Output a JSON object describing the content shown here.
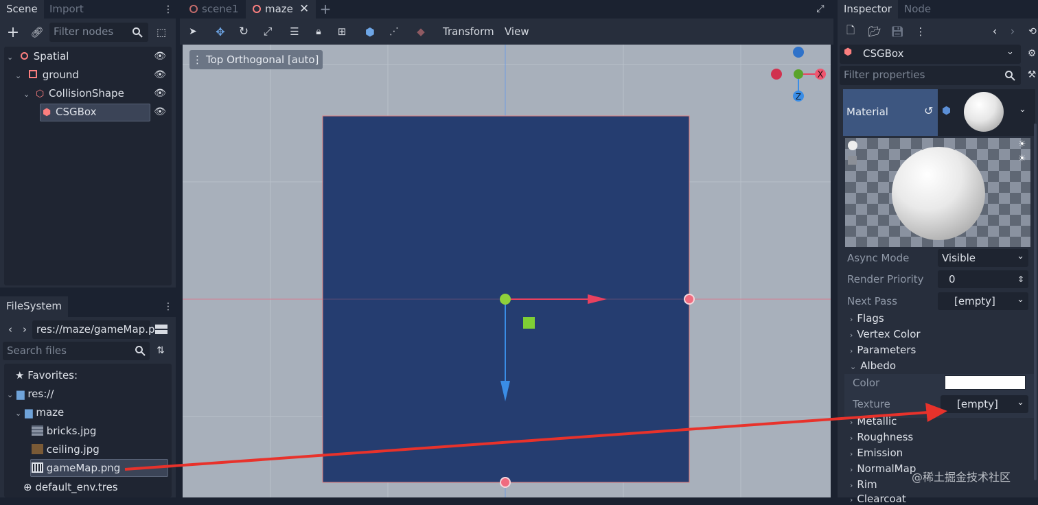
{
  "scene_dock": {
    "tabs": [
      "Scene",
      "Import"
    ],
    "filter_placeholder": "Filter nodes",
    "nodes": [
      "Spatial",
      "ground",
      "CollisionShape",
      "CSGBox"
    ]
  },
  "filesystem": {
    "tab": "FileSystem",
    "path": "res://maze/gameMap.p",
    "search_placeholder": "Search files",
    "items": [
      "Favorites:",
      "res://",
      "maze",
      "bricks.jpg",
      "ceiling.jpg",
      "gameMap.png",
      "default_env.tres"
    ]
  },
  "editor_tabs": [
    "scene1",
    "maze"
  ],
  "toolbar": {
    "transform": "Transform",
    "view": "View"
  },
  "viewport": {
    "label": "Top Orthogonal [auto]",
    "gizmo": {
      "x": "X",
      "z": "Z"
    },
    "bg_color": "#a8b0bb",
    "box_color": "#253d70"
  },
  "inspector": {
    "tabs": [
      "Inspector",
      "Node"
    ],
    "object": "CSGBox",
    "filter_placeholder": "Filter properties",
    "material_label": "Material",
    "props": {
      "async_mode": {
        "label": "Async Mode",
        "value": "Visible"
      },
      "render_priority": {
        "label": "Render Priority",
        "value": "0"
      },
      "next_pass": {
        "label": "Next Pass",
        "value": "[empty]"
      }
    },
    "sections": [
      "Flags",
      "Vertex Color",
      "Parameters",
      "Albedo"
    ],
    "albedo": {
      "color_label": "Color",
      "texture_label": "Texture",
      "texture_value": "[empty]"
    },
    "sections_after": [
      "Metallic",
      "Roughness",
      "Emission",
      "NormalMap",
      "Rim",
      "Clearcoat"
    ]
  },
  "watermark": "@稀土掘金技术社区",
  "accent": "#5e9ed6",
  "arrow_color": "#e8322b"
}
